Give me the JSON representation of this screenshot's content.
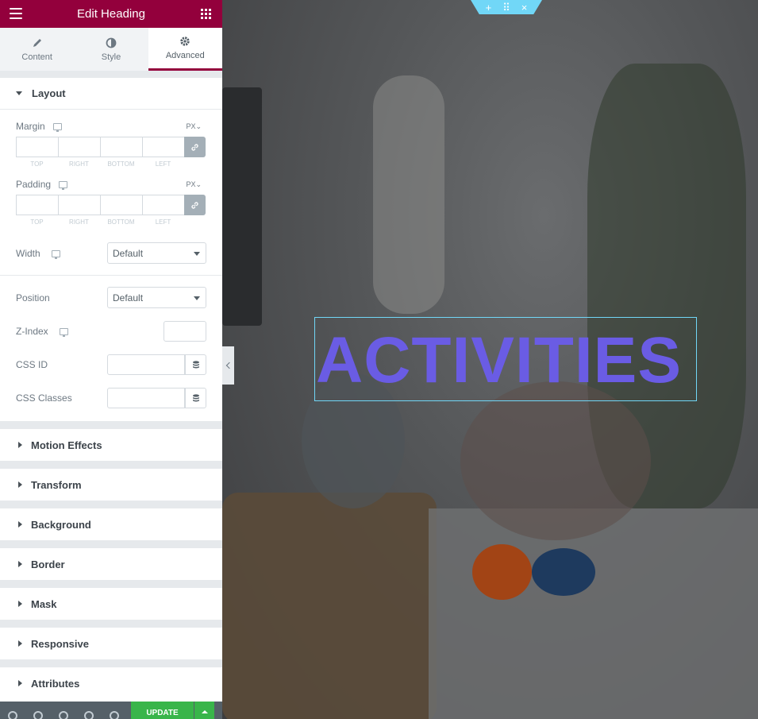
{
  "header": {
    "title": "Edit Heading"
  },
  "tabs": [
    {
      "label": "Content"
    },
    {
      "label": "Style"
    },
    {
      "label": "Advanced"
    }
  ],
  "layout": {
    "title": "Layout",
    "margin": {
      "label": "Margin",
      "unit": "PX",
      "sides": [
        "TOP",
        "RIGHT",
        "BOTTOM",
        "LEFT"
      ]
    },
    "padding": {
      "label": "Padding",
      "unit": "PX",
      "sides": [
        "TOP",
        "RIGHT",
        "BOTTOM",
        "LEFT"
      ]
    },
    "width": {
      "label": "Width",
      "value": "Default"
    },
    "position": {
      "label": "Position",
      "value": "Default"
    },
    "zindex": {
      "label": "Z-Index"
    },
    "css_id": {
      "label": "CSS ID"
    },
    "css_classes": {
      "label": "CSS Classes"
    }
  },
  "sections": [
    "Motion Effects",
    "Transform",
    "Background",
    "Border",
    "Mask",
    "Responsive",
    "Attributes"
  ],
  "footer": {
    "update_label": "UPDATE"
  },
  "preview": {
    "heading": "ACTIVITIES",
    "heading_color": "#6a5ce4"
  },
  "colors": {
    "brand": "#93003c",
    "update": "#39b54a",
    "selection": "#71d7f7"
  }
}
